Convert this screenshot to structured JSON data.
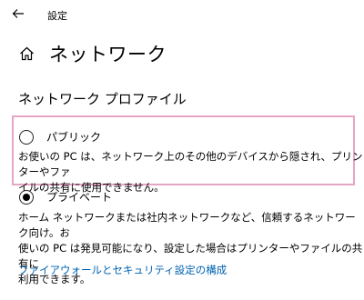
{
  "window": {
    "title": "設定"
  },
  "page": {
    "title": "ネットワーク"
  },
  "section": {
    "title": "ネットワーク プロファイル"
  },
  "profiles": [
    {
      "label": "パブリック",
      "selected": false,
      "description_line1": "お使いの PC は、ネットワーク上のその他のデバイスから隠され、プリンターやファ",
      "description_line2": "イルの共有に使用できません。"
    },
    {
      "label": "プライベート",
      "selected": true,
      "description_line1": "ホーム ネットワークまたは社内ネットワークなど、信頼するネットワーク向け。お",
      "description_line2": "使いの PC は発見可能になり、設定した場合はプリンターやファイルの共有に",
      "description_line3": "利用できます。"
    }
  ],
  "link": {
    "label": "ファイアウォールとセキュリティ設定の構成"
  },
  "colors": {
    "accent": "#0063b1",
    "highlight_border": "#e6a5c4"
  },
  "icons": {
    "back": "back-arrow-icon",
    "home": "home-icon"
  }
}
